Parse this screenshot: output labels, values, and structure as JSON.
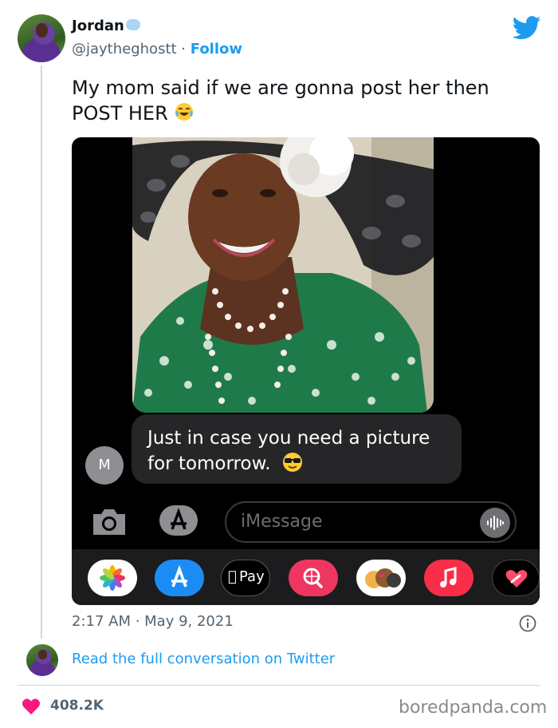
{
  "tweet": {
    "author_name": "Jordan",
    "handle": "@jaytheghostt",
    "separator": " · ",
    "follow_label": "Follow",
    "text_line1": "My mom said if we are gonna post her then",
    "text_line2": "POST HER",
    "timestamp": "2:17 AM · May 9, 2021",
    "read_full_label": "Read the full conversation on Twitter",
    "likes_count": "408.2K"
  },
  "screenshot": {
    "message_line1": "Just in case you need a picture",
    "message_line2": "for tomorrow.",
    "contact_initial": "M",
    "input_placeholder": "iMessage",
    "tray_apps": [
      "photos-app",
      "app-store",
      "apple-pay",
      "web-search",
      "memoji",
      "music",
      "digital-touch"
    ],
    "apple_pay_label": "Pay"
  },
  "watermark": "boredpanda.com",
  "colors": {
    "twitter_blue": "#1d9bf0",
    "like_pink": "#f91880",
    "text_primary": "#0f1419",
    "text_secondary": "#536471"
  }
}
